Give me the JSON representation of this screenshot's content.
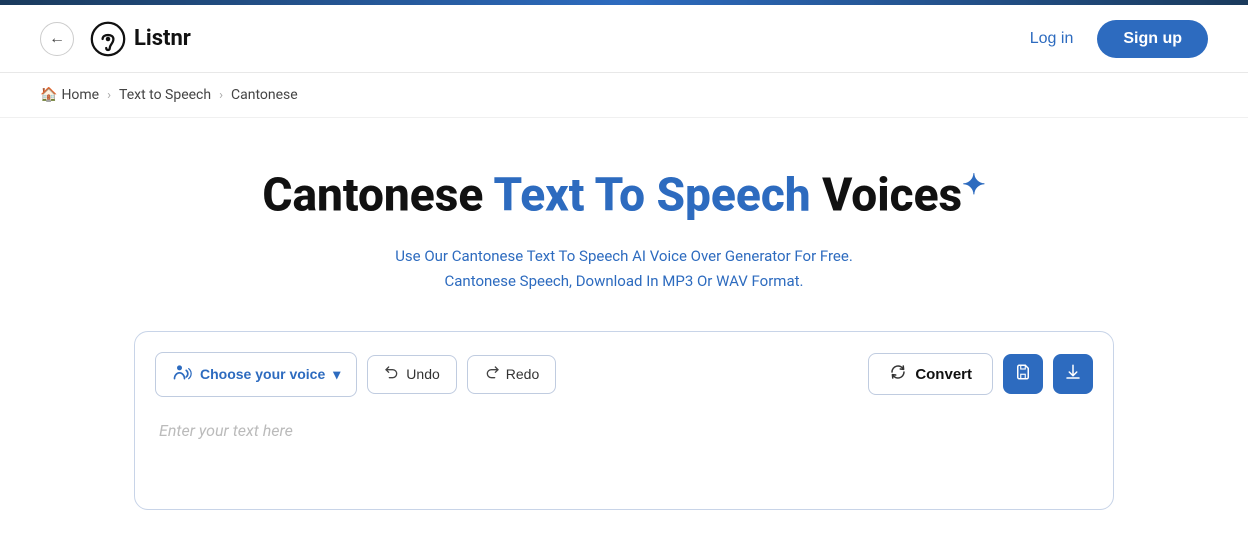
{
  "topbar": {
    "accent": true
  },
  "header": {
    "back_label": "←",
    "logo_text": "Listnr",
    "login_label": "Log in",
    "signup_label": "Sign up"
  },
  "breadcrumb": {
    "home_label": "Home",
    "home_icon": "🏠",
    "separator": "›",
    "text_to_speech": "Text to Speech",
    "current": "Cantonese"
  },
  "hero": {
    "title_part1": "Cantonese ",
    "title_blue": "Text To Speech",
    "title_part2": " Voices",
    "sparkle": "✦",
    "subtitle_line1": "Use Our Cantonese Text To Speech AI Voice Over Generator For Free.",
    "subtitle_line2": "Cantonese Speech, Download In MP3 Or WAV Format."
  },
  "toolbar": {
    "voice_label": "Choose your voice",
    "voice_dropdown": "▾",
    "undo_label": "Undo",
    "redo_label": "Redo",
    "convert_label": "Convert",
    "convert_icon": "🔄",
    "save_icon": "💾",
    "download_icon": "⬇"
  },
  "textarea": {
    "placeholder": "Enter your text here"
  }
}
